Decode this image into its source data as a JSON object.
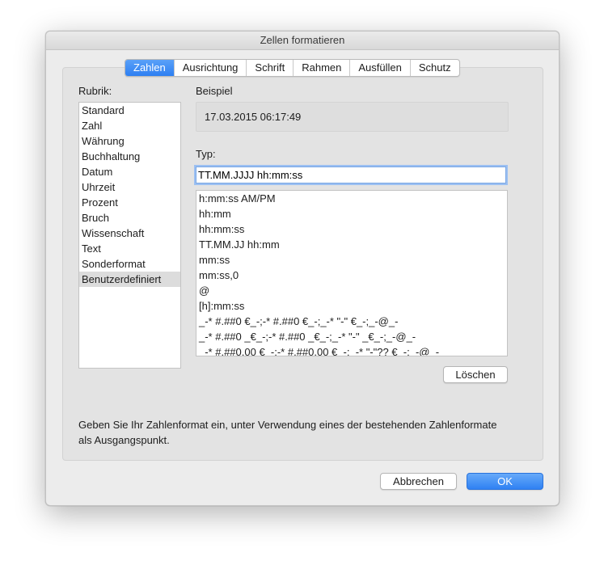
{
  "window": {
    "title": "Zellen formatieren"
  },
  "tabs": [
    {
      "label": "Zahlen",
      "active": true
    },
    {
      "label": "Ausrichtung",
      "active": false
    },
    {
      "label": "Schrift",
      "active": false
    },
    {
      "label": "Rahmen",
      "active": false
    },
    {
      "label": "Ausfüllen",
      "active": false
    },
    {
      "label": "Schutz",
      "active": false
    }
  ],
  "category": {
    "label": "Rubrik:",
    "items": [
      "Standard",
      "Zahl",
      "Währung",
      "Buchhaltung",
      "Datum",
      "Uhrzeit",
      "Prozent",
      "Bruch",
      "Wissenschaft",
      "Text",
      "Sonderformat",
      "Benutzerdefiniert"
    ],
    "selected": "Benutzerdefiniert"
  },
  "sample": {
    "label": "Beispiel",
    "value": "17.03.2015 06:17:49"
  },
  "type": {
    "label": "Typ:",
    "value": "TT.MM.JJJJ hh:mm:ss",
    "formats": [
      "h:mm:ss AM/PM",
      "hh:mm",
      "hh:mm:ss",
      "TT.MM.JJ hh:mm",
      "mm:ss",
      "mm:ss,0",
      "@",
      "[h]:mm:ss",
      "_-* #.##0 €_-;-* #.##0 €_-;_-* \"-\" €_-;_-@_-",
      "_-* #.##0 _€_-;-* #.##0 _€_-;_-* \"-\" _€_-;_-@_-",
      "_-* #.##0,00 €_-;-* #.##0,00 €_-;_-* \"-\"?? €_-;_-@_-"
    ]
  },
  "buttons": {
    "delete": "Löschen",
    "cancel": "Abbrechen",
    "ok": "OK"
  },
  "hint": "Geben Sie Ihr Zahlenformat ein, unter Verwendung eines der bestehenden Zahlenformate als Ausgangspunkt.",
  "colors": {
    "accent": "#2f81f3",
    "dialog_bg": "#ececec",
    "selected_row": "#dcdcdc"
  }
}
